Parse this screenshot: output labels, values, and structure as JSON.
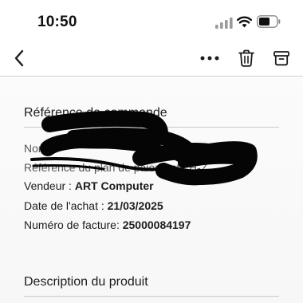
{
  "status_bar": {
    "time": "10:50",
    "icons": [
      "signal-icon",
      "wifi-icon",
      "battery-icon"
    ]
  },
  "nav": {
    "icons": [
      "chevron-left-icon",
      "more-icon",
      "trash-icon",
      "archive-icon"
    ]
  },
  "order_section": {
    "title": "Référence de commande",
    "name_label": "Nom",
    "payment_plan_label": "Référence du plan de paiement : H-Z",
    "payment_plan_tail": "K",
    "vendor_label": "Vendeur : ",
    "vendor_value": "ART Computer",
    "purchase_date_label": "Date de l'achat : ",
    "purchase_date_value": "21/03/2025",
    "invoice_label": "Numéro de facture: ",
    "invoice_value": "25000084197"
  },
  "product_section": {
    "title": "Description du produit"
  },
  "colors": {
    "text": "#1c1c1e",
    "divider": "#c9c9cc",
    "redaction": "#050505"
  }
}
